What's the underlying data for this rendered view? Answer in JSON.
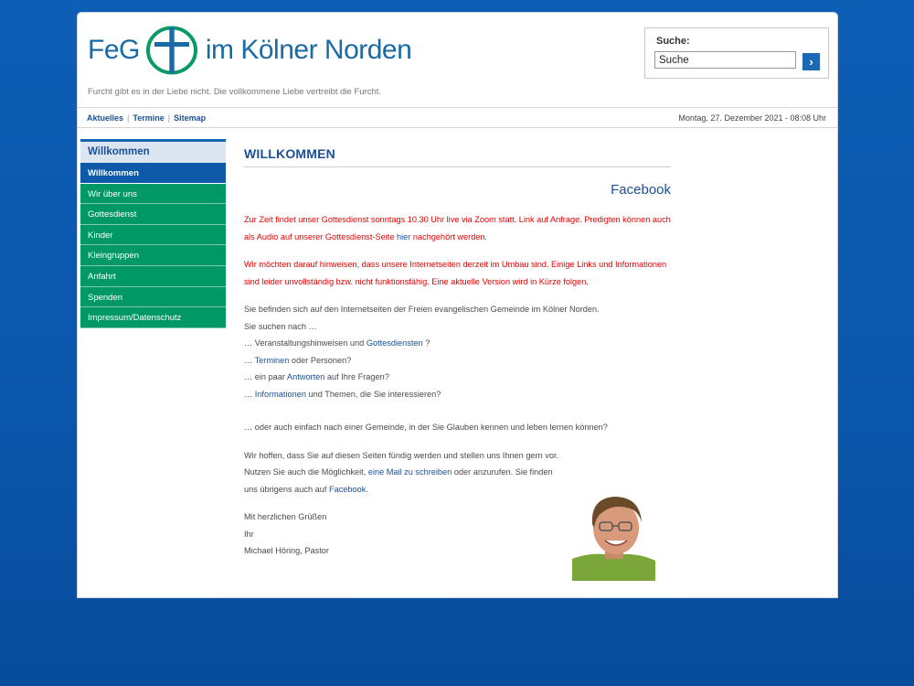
{
  "header": {
    "logo_feg": "FeG",
    "logo_rest": "im Kölner Norden",
    "tagline": "Furcht gibt es in der Liebe nicht. Die vollkommene Liebe vertreibt die Furcht."
  },
  "search": {
    "label": "Suche:",
    "value": "Suche",
    "button_glyph": "›"
  },
  "topnav": {
    "links": [
      "Aktuelles",
      "Termine",
      "Sitemap"
    ],
    "separator": "|",
    "date": "Montag, 27. Dezember 2021 - 08:08 Uhr"
  },
  "sidebar": {
    "heading": "Willkommen",
    "items": [
      {
        "label": "Willkommen",
        "active": true
      },
      {
        "label": "Wir über uns",
        "active": false
      },
      {
        "label": "Gottesdienst",
        "active": false
      },
      {
        "label": "Kinder",
        "active": false
      },
      {
        "label": "Kleingruppen",
        "active": false
      },
      {
        "label": "Anfahrt",
        "active": false
      },
      {
        "label": "Spenden",
        "active": false
      },
      {
        "label": "Impressum/Datenschutz",
        "active": false
      }
    ]
  },
  "content": {
    "title": "WILLKOMMEN",
    "facebook_link": "Facebook",
    "notice1_a": "Zur Zeit findet unser Gottesdienst sonntags 10.30 Uhr live via Zoom statt. Link auf Anfrage. Predigten können auch als Audio auf unserer Gottesdienst-Seite ",
    "notice1_link": "hier",
    "notice1_b": " nachgehört werden.",
    "notice2": "Wir möchten darauf hinweisen, dass unsere Internetseiten derzeit im Umbau sind. Einige Links und Informationen sind leider unvollständig bzw. nicht funktionsfähig.  Eine aktuelle Version wird in Kürze folgen.",
    "intro1": "Sie befinden sich auf den Internetseiten der Freien evangelischen Gemeinde im Kölner Norden.",
    "intro2": "Sie suchen nach …",
    "q1_a": "… Veranstaltungshinweisen und ",
    "q1_link": "Gottesdiensten",
    "q1_b": " ?",
    "q2_a": "… ",
    "q2_link": "Terminen",
    "q2_b": " oder Personen?",
    "q3_a": "… ein paar ",
    "q3_link": "Antworten",
    "q3_b": " auf Ihre Fragen?",
    "q4_a": "… ",
    "q4_link": "Informationen",
    "q4_b": " und Themen, die Sie interessieren?",
    "q5": "… oder auch einfach nach einer Gemeinde, in der Sie Glauben kennen und leben lernen können?",
    "closing1": "Wir hoffen, dass Sie auf diesen Seiten fündig werden und stellen uns Ihnen gern vor.",
    "closing2_a": "Nutzen Sie auch die Möglichkeit, ",
    "closing2_link": "eine Mail zu schreiben",
    "closing2_b": " oder anzurufen. Sie finden",
    "closing3_a": "uns übrigens auch auf ",
    "closing3_link": "Facebook",
    "closing3_b": ".",
    "greeting1": "Mit herzlichen Grüßen",
    "greeting2": "Ihr",
    "greeting3": "Michael Höring, Pastor"
  },
  "colors": {
    "background_blue": "#0d5eb5",
    "link_blue": "#1a5096",
    "nav_green": "#009966",
    "nav_active": "#0f5aa8",
    "notice_red": "#e00000"
  }
}
